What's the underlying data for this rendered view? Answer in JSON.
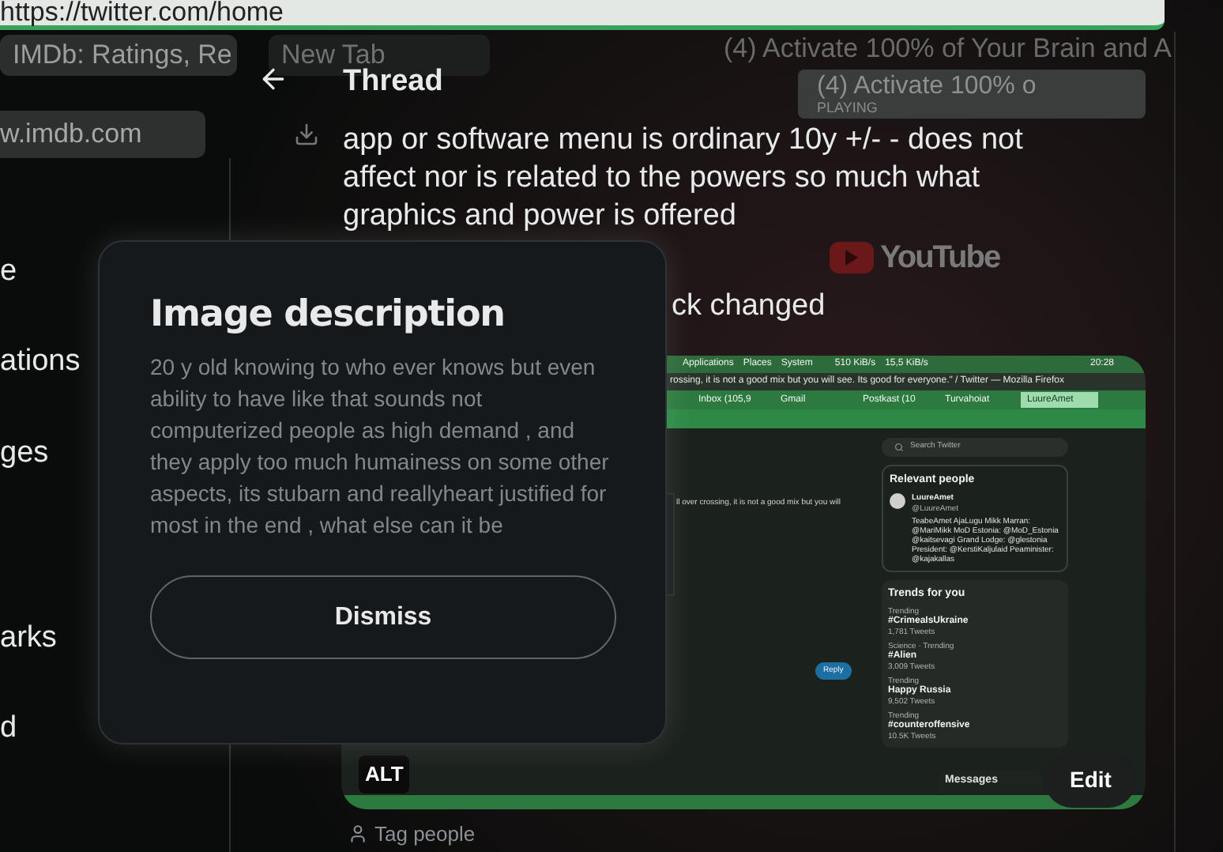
{
  "address_bar": {
    "url": "https://twitter.com/home"
  },
  "background_windows": {
    "tabs": [
      {
        "label": "IMDb: Ratings, Re",
        "selected": false
      },
      {
        "label": "New Tab",
        "selected": true
      }
    ],
    "url_field": "w.imdb.com",
    "youtube_title": "(4) Activate 100% of Your Brain and A",
    "youtube_tab": "(4) Activate 100% o",
    "youtube_tab_status": "PLAYING",
    "youtube_logo": "YouTube"
  },
  "sidebar": {
    "items": [
      "e",
      "ations",
      "ges",
      "arks",
      "d"
    ]
  },
  "thread": {
    "title": "Thread",
    "tweet_text": "app or software menu is ordinary 10y +/- - does not affect nor is related to the powers so much what graphics and power is offered",
    "tweet_text_2": "ck changed",
    "tag_people": "Tag people"
  },
  "media": {
    "alt_badge": "ALT",
    "edit_badge": "Edit",
    "screenshot": {
      "panel_items": [
        "Applications",
        "Places",
        "System"
      ],
      "net_down": "510 KiB/s",
      "net_up": "15,5 KiB/s",
      "clock": "20:28",
      "window_title": "rossing, it is not a good mix but you will see. Its good for everyone.\" / Twitter — Mozilla Firefox",
      "tabs": [
        {
          "label": "Inbox (105,9",
          "selected": false
        },
        {
          "label": "Gmail",
          "selected": false
        },
        {
          "label": "Postkast (10",
          "selected": false
        },
        {
          "label": "Turvahoiat",
          "selected": false
        },
        {
          "label": "LuureAmet",
          "selected": true
        }
      ],
      "tweet_snippet": "ll over crossing, it is not a good mix but you will",
      "reply_button": "Reply",
      "search_placeholder": "Search Twitter",
      "relevant_title": "Relevant people",
      "person_name": "LuureAmet",
      "person_handle": "@LuureAmet",
      "person_bio": "TeabeAmet AjaLugu Mikk Marran: @MariMikk MoD Estonia: @MoD_Estonia @kaitsevagi Grand Lodge: @glestonia President: @KerstiKaljulaid Peaminister: @kajakallas",
      "trends_title": "Trends for you",
      "trends": [
        {
          "category": "Trending",
          "tag": "#CrimeaIsUkraine",
          "count": "1,781 Tweets"
        },
        {
          "category": "Science · Trending",
          "tag": "#Alien",
          "count": "3,009 Tweets"
        },
        {
          "category": "Trending",
          "tag": "Happy Russia",
          "count": "9,502 Tweets"
        },
        {
          "category": "Trending",
          "tag": "#counteroffensive",
          "count": "10.5K Tweets"
        }
      ],
      "messages": "Messages"
    }
  },
  "dialog": {
    "title": "Image description",
    "body": "20 y old knowing to who ever knows but even ability to have like that sounds not computerized people as high demand , and they apply too much humainess on some other aspects, its stubarn and reallyheart justified for most in the end , what else can it be",
    "dismiss": "Dismiss"
  }
}
